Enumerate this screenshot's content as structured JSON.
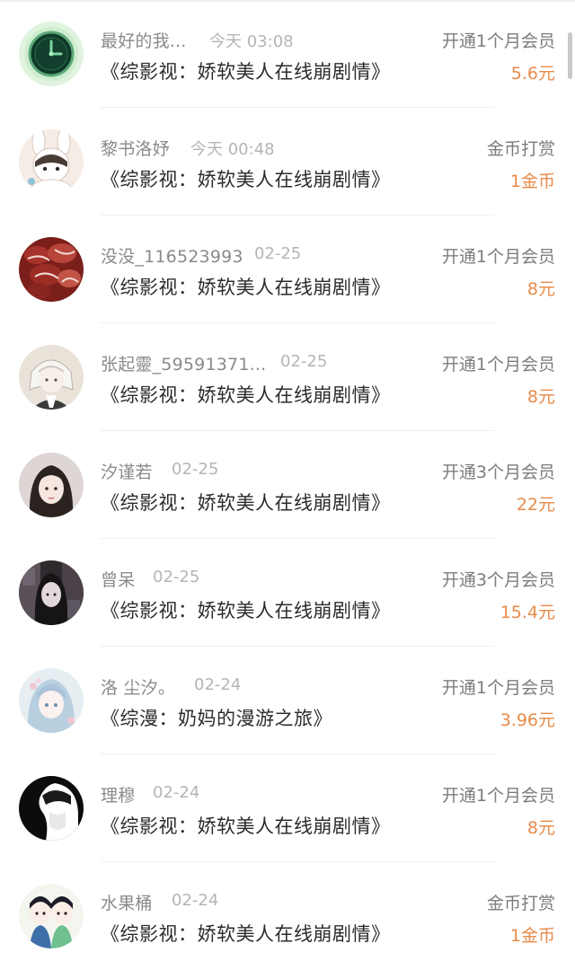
{
  "rows": [
    {
      "name": "最好的我...",
      "time": "今天 03:08",
      "title": "《综影视：娇软美人在线崩剧情》",
      "type": "开通1个月会员",
      "amount": "5.6元",
      "avatar_icon": "clock-avatar-icon"
    },
    {
      "name": "黎书洛妤",
      "time": "今天 00:48",
      "title": "《综影视：娇软美人在线崩剧情》",
      "type": "金币打赏",
      "amount": "1金币",
      "avatar_icon": "bunny-girl-avatar-icon"
    },
    {
      "name": "没没_116523993",
      "time": "02-25",
      "title": "《综影视：娇软美人在线崩剧情》",
      "type": "开通1个月会员",
      "amount": "8元",
      "avatar_icon": "meat-photo-avatar-icon"
    },
    {
      "name": "张起靈_59591371...",
      "time": "02-25",
      "title": "《综影视：娇软美人在线崩剧情》",
      "type": "开通1个月会员",
      "amount": "8元",
      "avatar_icon": "anime-boy-avatar-icon"
    },
    {
      "name": "汐谨若",
      "time": "02-25",
      "title": "《综影视：娇软美人在线崩剧情》",
      "type": "开通3个月会员",
      "amount": "22元",
      "avatar_icon": "girl-portrait-avatar-icon"
    },
    {
      "name": "曾呆",
      "time": "02-25",
      "title": "《综影视：娇软美人在线崩剧情》",
      "type": "开通3个月会员",
      "amount": "15.4元",
      "avatar_icon": "dark-girl-avatar-icon"
    },
    {
      "name": "洛 尘汐。",
      "time": "02-24",
      "title": "《综漫：奶妈的漫游之旅》",
      "type": "开通1个月会员",
      "amount": "3.96元",
      "avatar_icon": "anime-girl-avatar-icon"
    },
    {
      "name": "理穆",
      "time": "02-24",
      "title": "《综影视：娇软美人在线崩剧情》",
      "type": "开通1个月会员",
      "amount": "8元",
      "avatar_icon": "silhouette-avatar-icon"
    },
    {
      "name": "水果桶",
      "time": "02-24",
      "title": "《综影视：娇软美人在线崩剧情》",
      "type": "金币打赏",
      "amount": "1金币",
      "avatar_icon": "chibi-couple-avatar-icon"
    }
  ],
  "colors": {
    "amount": "#e88b4a",
    "name": "#8a8a8a",
    "time": "#b5b5b5",
    "title": "#2b2b2b",
    "type": "#7c7c7c"
  }
}
